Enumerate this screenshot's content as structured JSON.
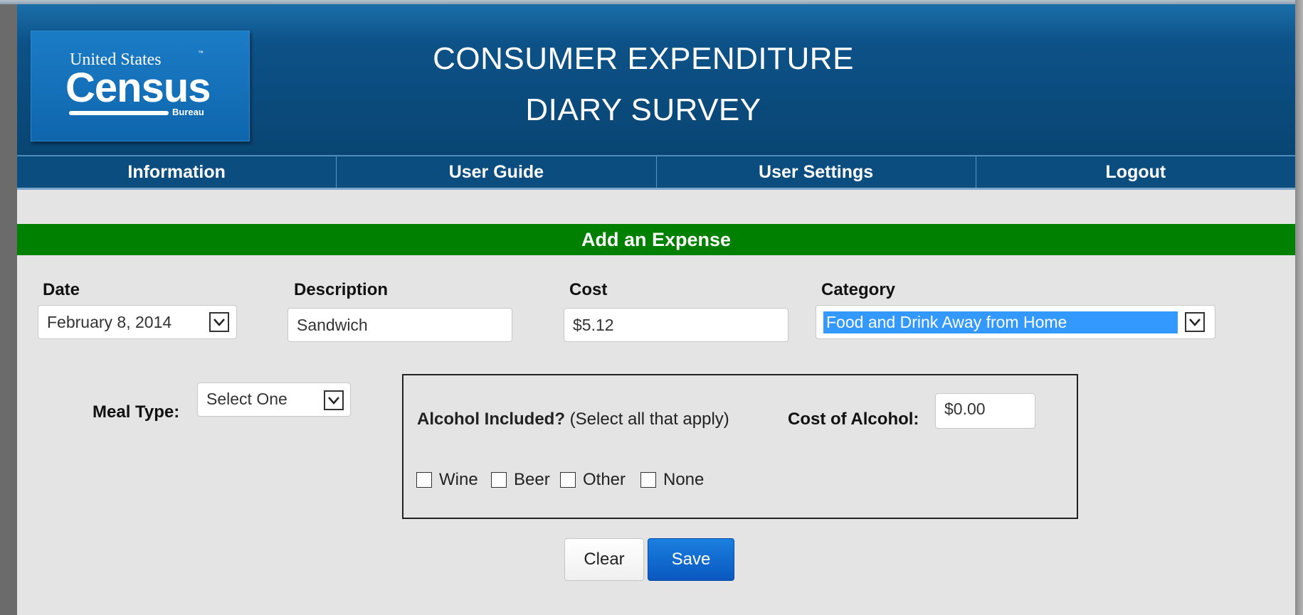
{
  "header": {
    "logo": {
      "line1": "United States",
      "trademark": "™",
      "line2": "Census",
      "line3": "Bureau"
    },
    "title_line1": "CONSUMER EXPENDITURE",
    "title_line2": "DIARY SURVEY"
  },
  "nav": {
    "items": [
      {
        "label": "Information"
      },
      {
        "label": "User Guide"
      },
      {
        "label": "User Settings"
      },
      {
        "label": "Logout"
      }
    ]
  },
  "form": {
    "heading": "Add an Expense",
    "date": {
      "label": "Date",
      "value": "February 8, 2014"
    },
    "description": {
      "label": "Description",
      "value": "Sandwich"
    },
    "cost": {
      "label": "Cost",
      "value": "$5.12"
    },
    "category": {
      "label": "Category",
      "value": "Food and Drink Away from Home"
    },
    "meal_type": {
      "label": "Meal Type:",
      "value": "Select One"
    },
    "alcohol": {
      "question": "Alcohol Included?",
      "hint": "(Select all that apply)",
      "cost_label": "Cost of Alcohol:",
      "cost_value": "$0.00",
      "options": [
        {
          "label": "Wine",
          "checked": false
        },
        {
          "label": "Beer",
          "checked": false
        },
        {
          "label": "Other",
          "checked": false
        },
        {
          "label": "None",
          "checked": false
        }
      ]
    },
    "buttons": {
      "clear": "Clear",
      "save": "Save"
    }
  },
  "colors": {
    "header_blue": "#0d5288",
    "green_bar": "#008000",
    "save_blue": "#0a58c0",
    "selection_blue": "#3399ff"
  }
}
